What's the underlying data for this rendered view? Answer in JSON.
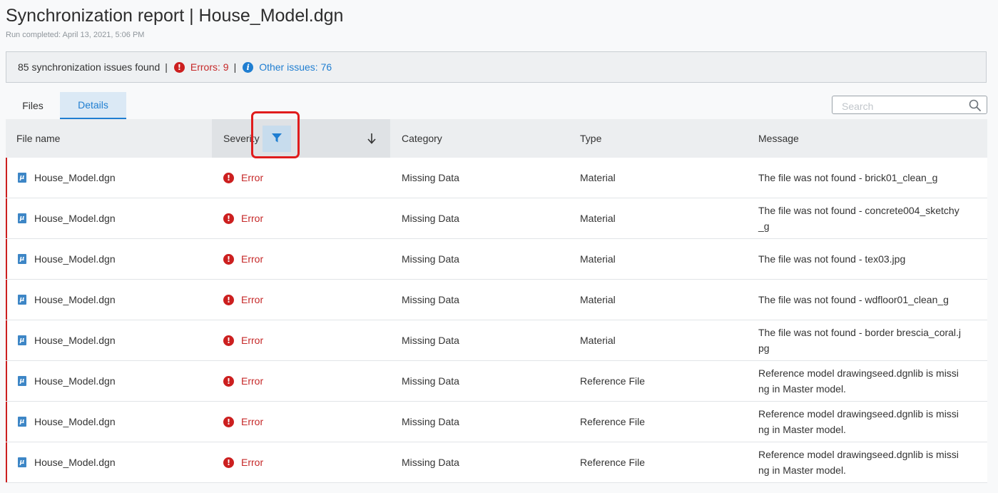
{
  "header": {
    "title": "Synchronization report | House_Model.dgn",
    "subtitle": "Run completed: April 13, 2021, 5:06 PM"
  },
  "summary": {
    "total": "85 synchronization issues found",
    "errors": "Errors: 9",
    "other": "Other issues: 76"
  },
  "tabs": [
    {
      "label": "Files",
      "active": false
    },
    {
      "label": "Details",
      "active": true
    }
  ],
  "search": {
    "placeholder": "Search",
    "value": ""
  },
  "table": {
    "columns": [
      "File name",
      "Severity",
      "Category",
      "Type",
      "Message"
    ],
    "rows": [
      {
        "file": "House_Model.dgn",
        "severity": "Error",
        "category": "Missing Data",
        "type": "Material",
        "message": "The file was not found - brick01_clean_g"
      },
      {
        "file": "House_Model.dgn",
        "severity": "Error",
        "category": "Missing Data",
        "type": "Material",
        "message": "The file was not found - concrete004_sketchy_g"
      },
      {
        "file": "House_Model.dgn",
        "severity": "Error",
        "category": "Missing Data",
        "type": "Material",
        "message": "The file was not found - tex03.jpg"
      },
      {
        "file": "House_Model.dgn",
        "severity": "Error",
        "category": "Missing Data",
        "type": "Material",
        "message": "The file was not found - wdfloor01_clean_g"
      },
      {
        "file": "House_Model.dgn",
        "severity": "Error",
        "category": "Missing Data",
        "type": "Material",
        "message": "The file was not found - border brescia_coral.jpg"
      },
      {
        "file": "House_Model.dgn",
        "severity": "Error",
        "category": "Missing Data",
        "type": "Reference File",
        "message": "Reference model drawingseed.dgnlib is missing in Master model."
      },
      {
        "file": "House_Model.dgn",
        "severity": "Error",
        "category": "Missing Data",
        "type": "Reference File",
        "message": "Reference model drawingseed.dgnlib is missing in Master model."
      },
      {
        "file": "House_Model.dgn",
        "severity": "Error",
        "category": "Missing Data",
        "type": "Reference File",
        "message": "Reference model drawingseed.dgnlib is missing in Master model."
      }
    ]
  },
  "colors": {
    "accent": "#1f7ed1",
    "error": "#cc1f1f",
    "highlight": "#e01c1c"
  },
  "icons": {
    "error": "error-circle-icon",
    "info": "info-circle-icon",
    "filter": "filter-funnel-icon",
    "sort": "arrow-down-icon",
    "search": "search-icon",
    "file": "dgn-file-icon"
  }
}
